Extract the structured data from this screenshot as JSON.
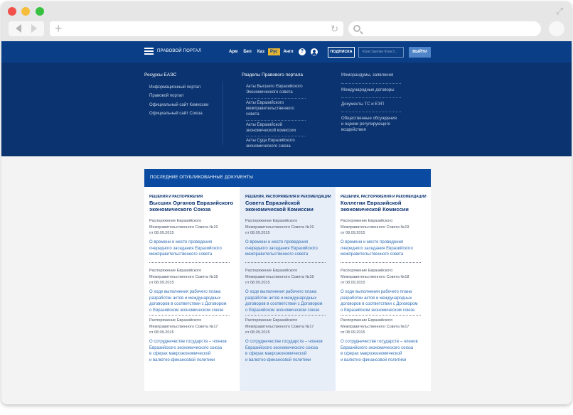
{
  "site": {
    "portal_title": "ПРАВОВОЙ ПОРТАЛ",
    "languages": [
      "Арм",
      "Бел",
      "Каз",
      "Рус",
      "Англ"
    ],
    "active_language": "Рус",
    "subscribe_label": "ПОДПИСКА",
    "login_placeholder": "Константин Конст...",
    "login_label": "ВЫЙТИ",
    "help_glyph": "?"
  },
  "megamenu": {
    "resources": {
      "title": "Ресурсы ЕАЭС",
      "items": [
        "Информационный портал",
        "Правовой портал",
        "Официальный сайт Комиссии",
        "Официальный сайт Союза"
      ]
    },
    "sections": {
      "title": "Разделы Правового портала",
      "items": [
        "Акты Высшего Евразийского\nЭкономического совета",
        "Акты Евразийского\nмежправительственного\nсовета",
        "Акты Евразийской\nэкономической комиссии",
        "Акты Суда Евразийского\nэкономического союза"
      ]
    },
    "other": {
      "items": [
        "Меморандумы, заявления",
        "Международные договоры",
        "Документы ТС и ЕЭП",
        "Общественные обсуждения\nи оценки регулирующего\nвоздействия"
      ]
    }
  },
  "documents": {
    "header": "ПОСЛЕДНИЕ ОПУБЛИКОВАННЫЕ ДОКУМЕНТЫ",
    "columns": [
      {
        "category": "РЕШЕНИЯ И РАСПОРЯЖЕНИЯ",
        "title": "Высших Органов Евразийского\nэкономического Союза",
        "entries": [
          {
            "name": "Распоряжение Евразийского\nМежправительственного Совета №19",
            "date": "от 08.09.2015",
            "desc": "О времени и месте проведения\nочередного заседания Евразийского\nмежправительственного совета"
          },
          {
            "name": "Распоряжение Евразийского\nМежправительственного Совета №18",
            "date": "от 08.09.2015",
            "desc": "О ходе выполнения рабочего плана\nразработки актов и международных\nдоговоров в соответствии с Договором\nо Евразийском экономическом союзе"
          },
          {
            "name": "Распоряжение Евразийского\nМежправительственного Совета №17",
            "date": "от 08.09.2015",
            "desc": "О сотрудничестве государств – членов\nЕвразийского экономического союза\nв сферах макроэкономической\nи валютно-финансовой политики"
          }
        ]
      },
      {
        "category": "РЕШЕНИЯ, РАСПОРЯЖЕНИЯ И РЕКОМЕНДАЦИИ",
        "title": "Совета Евразийской\nэкономической Комиссии",
        "entries": [
          {
            "name": "Распоряжение Евразийского\nМежправительственного Совета №19",
            "date": "от 08.09.2015",
            "desc": "О времени и месте проведения\nочередного заседания Евразийского\nмежправительственного совета"
          },
          {
            "name": "Распоряжение Евразийского\nМежправительственного Совета №18",
            "date": "от 08.09.2015",
            "desc": "О ходе выполнения рабочего плана\nразработки актов и международных\nдоговоров в соответствии с Договором\nо Евразийском экономическом союзе"
          },
          {
            "name": "Распоряжение Евразийского\nМежправительственного Совета №17",
            "date": "от 08.09.2015",
            "desc": "О сотрудничестве государств – членов\nЕвразийского экономического союза\nв сферах макроэкономической\nи валютно-финансовой политики"
          }
        ]
      },
      {
        "category": "РЕШЕНИЯ, РАСПОРЯЖЕНИЯ И РЕКОМЕНДАЦИИ",
        "title": "Коллегии Евразийской\nэкономической Комиссии",
        "entries": [
          {
            "name": "Распоряжение Евразийского\nМежправительственного Совета №19",
            "date": "от 08.09.2015",
            "desc": "О времени и месте проведения\nочередного заседания Евразийского\nмежправительственного совета"
          },
          {
            "name": "Распоряжение Евразийского\nМежправительственного Совета №18",
            "date": "от 08.09.2015",
            "desc": "О ходе выполнения рабочего плана\nразработки актов и международных\nдоговоров в соответствии с Договором\nо Евразийском экономическом союзе"
          },
          {
            "name": "Распоряжение Евразийского\nМежправительственного Совета №17",
            "date": "от 08.09.2015",
            "desc": "О сотрудничестве государств – членов\nЕвразийского экономического союза\nв сферах макроэкономической\nи валютно-финансовой политики"
          }
        ]
      }
    ]
  },
  "colors": {
    "header_blue": "#0a3f87",
    "menu_blue": "#0a3370",
    "accent_yellow": "#e4b434",
    "link_blue": "#2f6db5"
  },
  "icons": [
    "close-dot",
    "minimize-dot",
    "zoom-dot",
    "back-arrow-icon",
    "forward-arrow-icon",
    "plus-icon",
    "reload-icon",
    "search-icon",
    "profile-icon",
    "hamburger-icon",
    "help-icon",
    "user-icon",
    "expand-icon"
  ]
}
